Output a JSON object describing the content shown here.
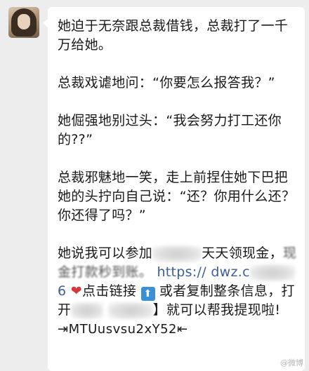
{
  "message": {
    "p1": "她迫于无奈跟总裁借钱，总裁打了一千万给她。",
    "p2": "总裁戏谑地问：“你要怎么报答我？”",
    "p3": "她倔强地别过头：“我会努力打工还你的??”",
    "p4": "总裁邪魅地一笑，走上前捏住她下巴把她的头拧向自己说：“还？你用什么还？你还得了吗？”",
    "p5_a": "她说我可以参加",
    "p5_b": "天天领现金，",
    "p5_c": "现金打款秒到账。",
    "link_a": "https://",
    "link_b": "dwz.c",
    "link_c": "6",
    "heart": "❤",
    "p6_a": "点击链接",
    "arrow": "⬆",
    "p6_b": "或者复制整条信息，打开",
    "p6_c": "】就可以帮我提现啦!",
    "code": "⇥MTUusvsu2xY52⇤"
  },
  "watermark": "@微博"
}
